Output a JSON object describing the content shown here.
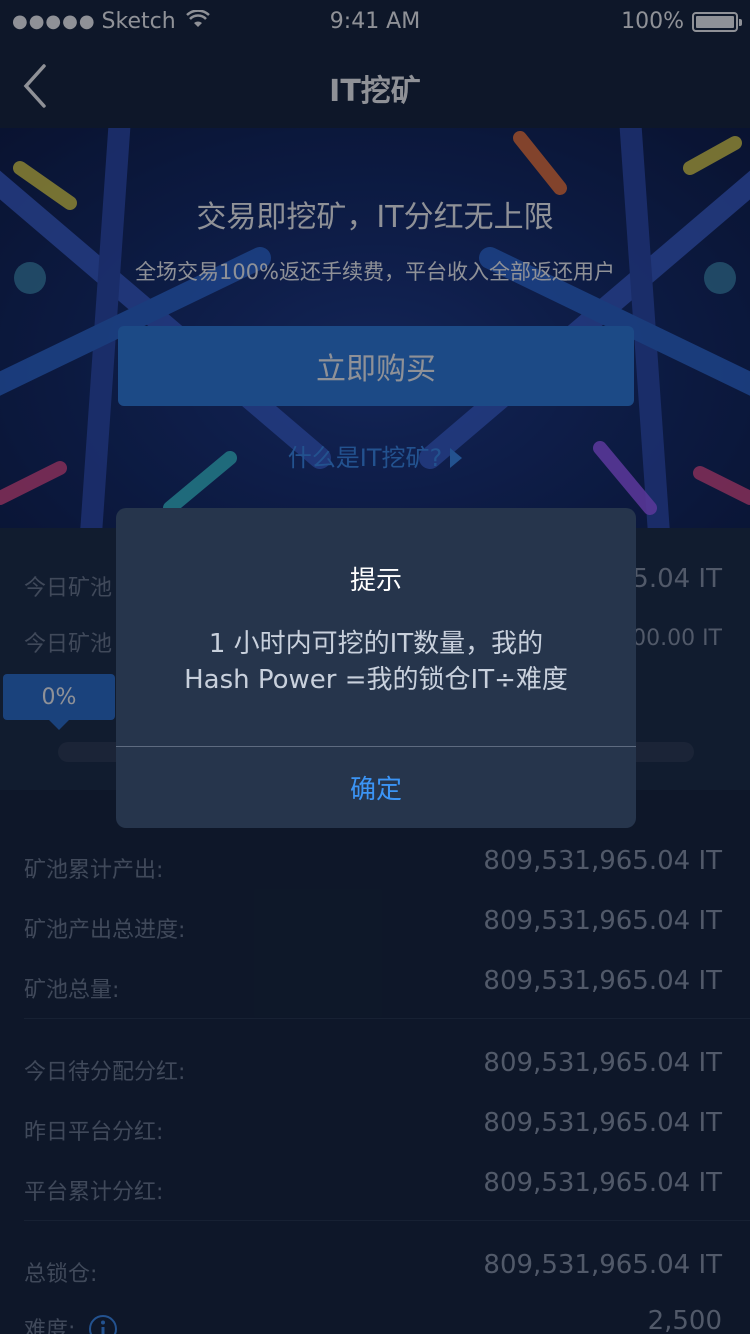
{
  "status_bar": {
    "carrier": "Sketch",
    "time": "9:41 AM",
    "battery": "100%"
  },
  "nav": {
    "title": "IT挖矿"
  },
  "banner": {
    "headline": "交易即挖矿，IT分红无上限",
    "subline": "全场交易100%返还手续费，平台收入全部返还用户",
    "buy_label": "立即购买",
    "what_label": "什么是IT挖矿?"
  },
  "today": {
    "rows": [
      {
        "label": "今日矿池",
        "value": "5.04 IT"
      },
      {
        "label": "今日矿池",
        "value": "00.00 IT"
      }
    ],
    "progress_label": "0%",
    "progress_value": 0
  },
  "stats": {
    "rows": [
      {
        "label": "矿池累计产出:",
        "value": "809,531,965.04 IT"
      },
      {
        "label": "矿池产出总进度:",
        "value": "809,531,965.04 IT"
      },
      {
        "label": "矿池总量:",
        "value": "809,531,965.04 IT"
      },
      {
        "label": "今日待分配分红:",
        "value": "809,531,965.04 IT"
      },
      {
        "label": "昨日平台分红:",
        "value": "809,531,965.04 IT"
      },
      {
        "label": "平台累计分红:",
        "value": "809,531,965.04 IT"
      },
      {
        "label": "总锁仓:",
        "value": "809,531,965.04 IT"
      },
      {
        "label": "难度:",
        "value": "2,500"
      }
    ]
  },
  "modal": {
    "title": "提示",
    "message_line1": "1 小时内可挖的IT数量，我的",
    "message_line2": "Hash Power =我的锁仓IT÷难度",
    "ok_label": "确定"
  },
  "colors": {
    "accent": "#3b94f5",
    "button": "#2f7fe0",
    "background": "#152237"
  }
}
